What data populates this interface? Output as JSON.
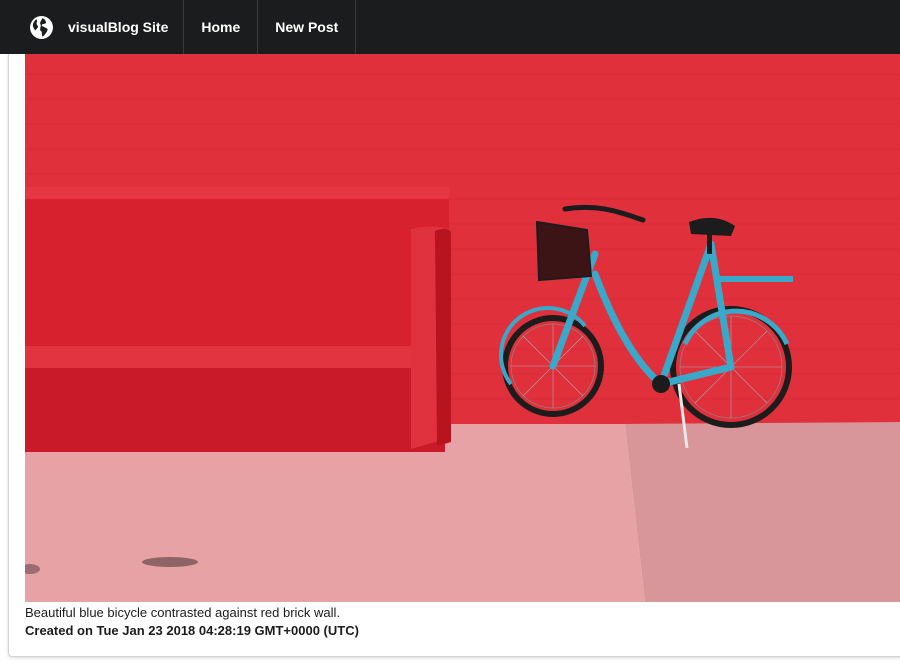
{
  "navbar": {
    "brand_label": "visualBlog Site",
    "brand_icon": "globe-icon",
    "items": [
      {
        "label": "Home"
      },
      {
        "label": "New Post"
      }
    ],
    "background": "#1b1c1d"
  },
  "post": {
    "caption": "Beautiful blue bicycle contrasted against red brick wall.",
    "created": "Created on Tue Jan 23 2018 04:28:19 GMT+0000 (UTC)",
    "photo_colors": {
      "wall": "#e0303c",
      "bench": "#d8212e",
      "ground": "#e8a0a4",
      "bicycle": "#3aa8c8"
    }
  }
}
